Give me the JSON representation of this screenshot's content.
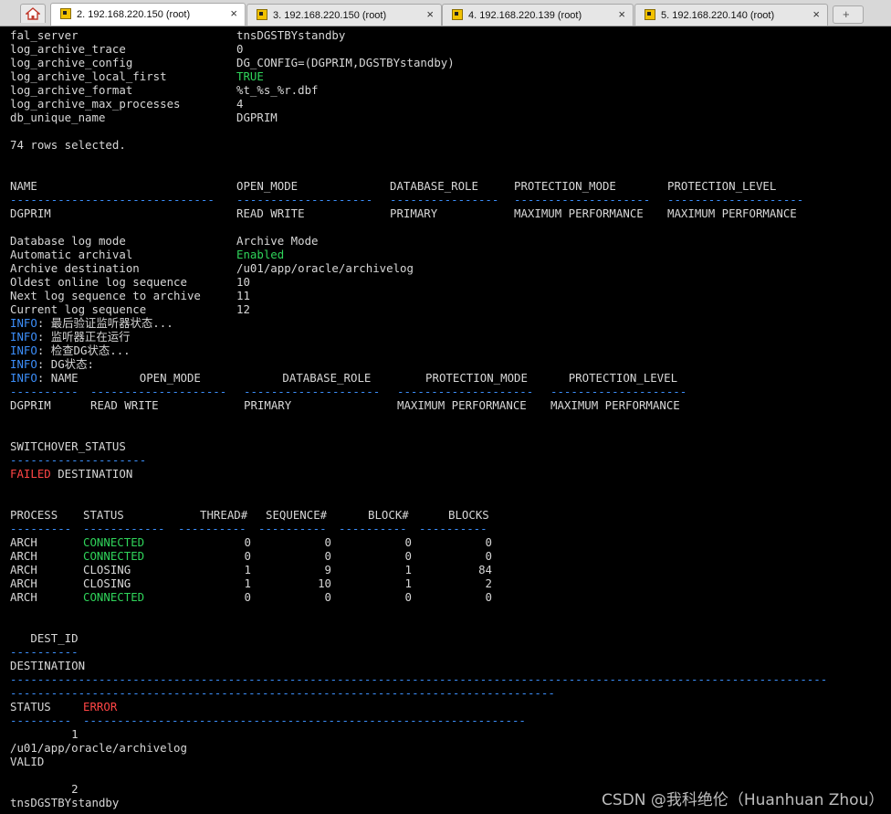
{
  "tabs": [
    {
      "label": "2. 192.168.220.150 (root)",
      "active": true,
      "close": "×"
    },
    {
      "label": "3. 192.168.220.150 (root)",
      "active": false,
      "close": "×"
    },
    {
      "label": "4. 192.168.220.139 (root)",
      "active": false,
      "close": "×"
    },
    {
      "label": "5. 192.168.220.140 (root)",
      "active": false,
      "close": "×"
    }
  ],
  "colors": {
    "green": "#2fd45a",
    "blue": "#3c8ffb",
    "red": "#ff4545",
    "text": "#d7d7d7"
  },
  "params": [
    {
      "name": "fal_server",
      "value": "tnsDGSTBYstandby"
    },
    {
      "name": "log_archive_trace",
      "value": "0"
    },
    {
      "name": "log_archive_config",
      "value": "DG_CONFIG=(DGPRIM,DGSTBYstandby)"
    },
    {
      "name": "log_archive_local_first",
      "value": "TRUE"
    },
    {
      "name": "log_archive_format",
      "value": "%t_%s_%r.dbf"
    },
    {
      "name": "log_archive_max_processes",
      "value": "4"
    },
    {
      "name": "db_unique_name",
      "value": "DGPRIM"
    }
  ],
  "rows_selected": "74 rows selected.",
  "db_table": {
    "headers": [
      "NAME",
      "OPEN_MODE",
      "DATABASE_ROLE",
      "PROTECTION_MODE",
      "PROTECTION_LEVEL"
    ],
    "dashes": [
      "------------------------------",
      "--------------------",
      "----------------",
      "--------------------",
      "--------------------"
    ],
    "row": [
      "DGPRIM",
      "READ WRITE",
      "PRIMARY",
      "MAXIMUM PERFORMANCE",
      "MAXIMUM PERFORMANCE"
    ]
  },
  "archive": [
    {
      "label": "Database log mode",
      "value": "Archive Mode"
    },
    {
      "label": "Automatic archival",
      "value": "Enabled"
    },
    {
      "label": "Archive destination",
      "value": "/u01/app/oracle/archivelog"
    },
    {
      "label": "Oldest online log sequence",
      "value": "10"
    },
    {
      "label": "Next log sequence to archive",
      "value": "11"
    },
    {
      "label": "Current log sequence",
      "value": "12"
    }
  ],
  "info_prefix": "INFO",
  "info_lines": [
    ": 最后验证监听器状态...",
    ": 监听器正在运行",
    ": 检查DG状态...",
    ": DG状态:",
    ": NAME         OPEN_MODE            DATABASE_ROLE        PROTECTION_MODE      PROTECTION_LEVEL"
  ],
  "dg_dashes": [
    "----------",
    "--------------------",
    "--------------------",
    "--------------------",
    "--------------------"
  ],
  "dg_row": [
    "DGPRIM",
    "READ WRITE",
    "PRIMARY",
    "MAXIMUM PERFORMANCE",
    "MAXIMUM PERFORMANCE"
  ],
  "switchover": {
    "header": "SWITCHOVER_STATUS",
    "dashes": "--------------------",
    "failed": "FAILED",
    "rest": " DESTINATION"
  },
  "process_table": {
    "headers": [
      "PROCESS",
      "STATUS",
      "THREAD#",
      "SEQUENCE#",
      "BLOCK#",
      "BLOCKS"
    ],
    "dashes": [
      "---------",
      "------------",
      "----------",
      "----------",
      "----------",
      "----------"
    ],
    "rows": [
      [
        "ARCH",
        "CONNECTED",
        "0",
        "0",
        "0",
        "0"
      ],
      [
        "ARCH",
        "CONNECTED",
        "0",
        "0",
        "0",
        "0"
      ],
      [
        "ARCH",
        "CLOSING",
        "1",
        "9",
        "1",
        "84"
      ],
      [
        "ARCH",
        "CLOSING",
        "1",
        "10",
        "1",
        "2"
      ],
      [
        "ARCH",
        "CONNECTED",
        "0",
        "0",
        "0",
        "0"
      ]
    ]
  },
  "dest": {
    "dest_id_header": "   DEST_ID",
    "dest_id_dashes": "----------",
    "destination_header": "DESTINATION",
    "long_dashes_1": "------------------------------------------------------------------------------------------------------------------------",
    "long_dashes_2": "--------------------------------------------------------------------------------",
    "status_header": "STATUS",
    "error_header": "ERROR",
    "status_dashes": "---------",
    "error_dashes": "-----------------------------------------------------------------",
    "entries": [
      {
        "id": "         1",
        "destination": "/u01/app/oracle/archivelog",
        "status": "VALID"
      },
      {
        "id": "         2",
        "destination": "tnsDGSTBYstandby"
      }
    ]
  },
  "watermark": "CSDN @我科绝伦（Huanhuan Zhou）"
}
